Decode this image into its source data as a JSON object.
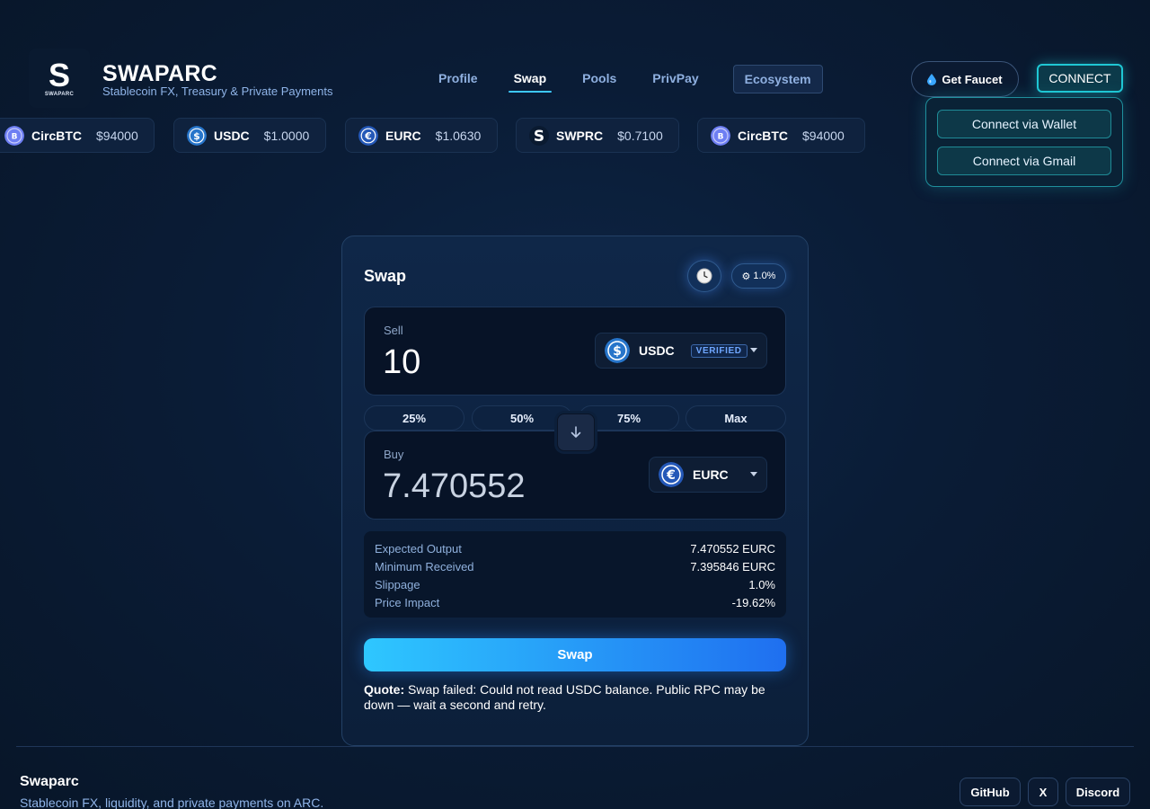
{
  "brand": {
    "logo_letter": "S",
    "logo_caption": "SWAPARC",
    "title": "SWAPARC",
    "subtitle": "Stablecoin FX, Treasury & Private Payments"
  },
  "nav": {
    "items": [
      {
        "label": "Profile"
      },
      {
        "label": "Swap",
        "active": true
      },
      {
        "label": "Pools"
      },
      {
        "label": "PrivPay"
      },
      {
        "label": "Ecosystem"
      }
    ]
  },
  "header": {
    "faucet_label": "Get Faucet",
    "connect_label": "CONNECT",
    "connect_menu": [
      "Connect via Wallet",
      "Connect via Gmail"
    ]
  },
  "ticker": [
    {
      "symbol": "CircBTC",
      "price": "$94000",
      "icon": "circbtc-icon"
    },
    {
      "symbol": "USDC",
      "price": "$1.0000",
      "icon": "usdc-icon"
    },
    {
      "symbol": "EURC",
      "price": "$1.0630",
      "icon": "eurc-icon"
    },
    {
      "symbol": "SWPRC",
      "price": "$0.7100",
      "icon": "swprc-icon"
    },
    {
      "symbol": "CircBTC",
      "price": "$94000",
      "icon": "circbtc-icon"
    }
  ],
  "swap": {
    "title": "Swap",
    "slippage_button": "1.0%",
    "sell": {
      "label": "Sell",
      "amount": "10",
      "token": "USDC",
      "badge": "VERIFIED"
    },
    "percent_buttons": [
      "25%",
      "50%",
      "75%",
      "Max"
    ],
    "buy": {
      "label": "Buy",
      "amount": "7.470552",
      "token": "EURC"
    },
    "details": [
      {
        "label": "Expected Output",
        "value": "7.470552 EURC"
      },
      {
        "label": "Minimum Received",
        "value": "7.395846 EURC"
      },
      {
        "label": "Slippage",
        "value": "1.0%"
      },
      {
        "label": "Price Impact",
        "value": "-19.62%"
      }
    ],
    "action_label": "Swap",
    "quote_label": "Quote:",
    "quote_text": " Swap failed: Could not read USDC balance. Public RPC may be down — wait a second and retry."
  },
  "footer": {
    "title": "Swaparc",
    "subtitle": "Stablecoin FX, liquidity, and private payments on ARC.",
    "links": [
      "GitHub",
      "X",
      "Discord"
    ]
  },
  "colors": {
    "accent_cyan": "#1fc7d4",
    "swap_gradient_start": "#2ec7ff",
    "swap_gradient_end": "#1f6ff0",
    "usdc_blue": "#2775ca",
    "circbtc_purple": "#7b6cf2"
  }
}
